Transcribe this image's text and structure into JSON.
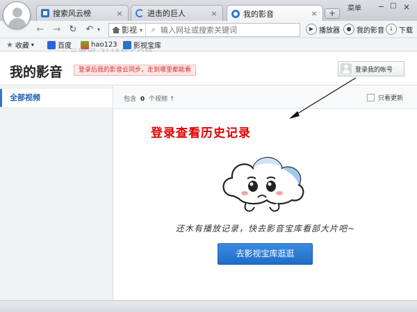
{
  "window": {
    "menu_label": "菜单",
    "minimize": "−",
    "maximize": "□",
    "close": "×"
  },
  "tabs": [
    {
      "label": "搜索风云榜",
      "icon": "film-icon",
      "close": "×",
      "active": false
    },
    {
      "label": "进击的巨人",
      "icon": "loading-spinner-icon",
      "close": "×",
      "active": false
    },
    {
      "label": "我的影音",
      "icon": "media-icon",
      "close": "×",
      "active": true
    }
  ],
  "new_tab": "+",
  "nav": {
    "back": "←",
    "forward": "→",
    "refresh": "↻",
    "undo": "↶",
    "undo_caret": "▾",
    "site_label": "影视",
    "site_caret": "▾",
    "search_glyph": "⌕",
    "address_placeholder": "输入网址或搜索关键词",
    "player_label": "播放器",
    "my_media_label": "我的影音",
    "download_label": "下载",
    "player_glyph": "▶",
    "my_media_glyph": "●",
    "download_glyph": "↓"
  },
  "bookmarks": {
    "favorites_label": "收藏",
    "favorites_caret": "▾",
    "items": [
      {
        "label": "百度",
        "icon": "baidu-paw-icon"
      },
      {
        "label": "hao123",
        "icon": "hao123-icon"
      },
      {
        "label": "影视宝库",
        "icon": "film-library-icon"
      }
    ]
  },
  "watermark": "三联网 3LIAN.COM",
  "header": {
    "title": "我的影音",
    "sync_notice": "登录后我的影音云同步，走到哪里都能看",
    "login_button": "登录我的帐号"
  },
  "sidebar": {
    "items": [
      {
        "label": "全部视频",
        "selected": true
      }
    ]
  },
  "content": {
    "count_prefix": "包含",
    "count_value": "0",
    "count_suffix": "个视频",
    "count_glyph": "↑",
    "only_updates_label": "只看更新",
    "prompt": "登录查看历史记录",
    "empty_message": "还木有播放记录，快去影音宝库看部大片吧~",
    "cta_button": "去影视宝库逛逛"
  },
  "colors": {
    "accent": "#2e78d2",
    "prompt_red": "#e00000",
    "notice_red": "#d03030"
  }
}
